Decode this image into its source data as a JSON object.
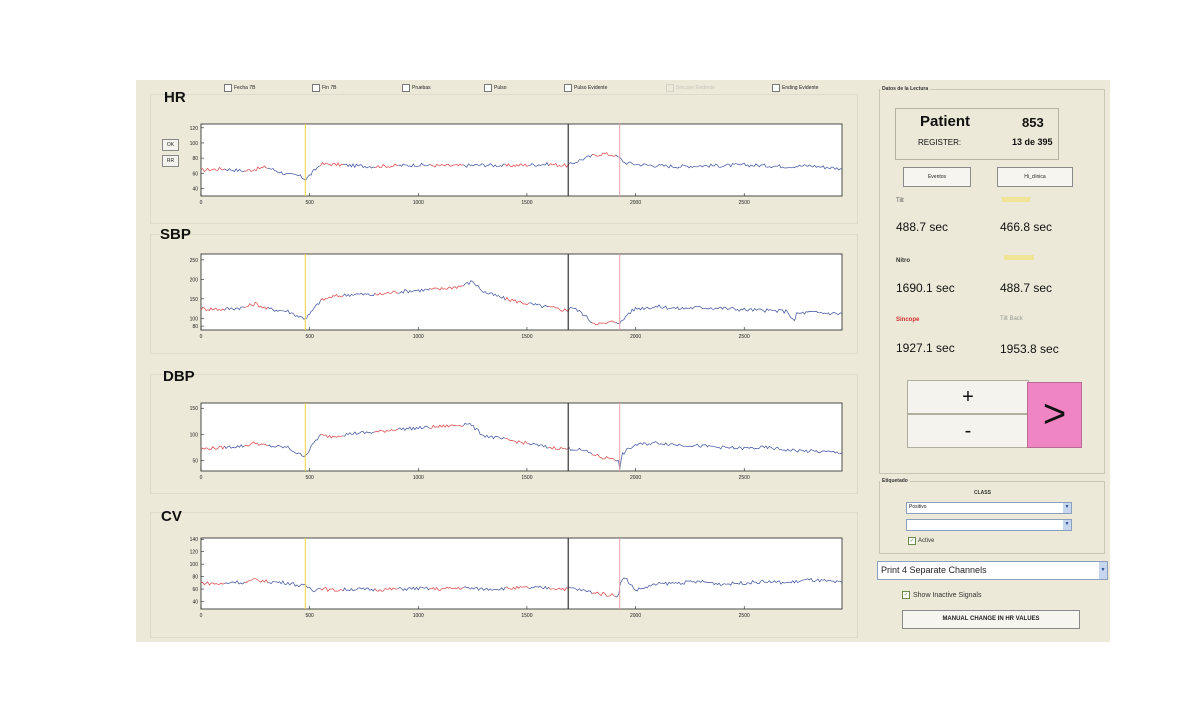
{
  "top_checkboxes": [
    {
      "label": "Fecha 7B",
      "disabled": false
    },
    {
      "label": "Fin 7B",
      "disabled": false
    },
    {
      "label": "Pruebas",
      "disabled": false
    },
    {
      "label": "Pulso",
      "disabled": false
    },
    {
      "label": "Pulso Evidente",
      "disabled": false
    },
    {
      "label": "Sincope Evidente",
      "disabled": true
    },
    {
      "label": "Ending Evidente",
      "disabled": false
    }
  ],
  "side_buttons": [
    "OK",
    "RR"
  ],
  "chart_data": [
    {
      "type": "line",
      "title": "HR",
      "ylim": [
        30,
        125
      ],
      "yticks": [
        40,
        60,
        80,
        100,
        120
      ],
      "xlim": [
        0,
        2950
      ],
      "xticks": [
        0,
        500,
        1000,
        1500,
        2000,
        2500
      ],
      "x": [
        0,
        100,
        200,
        300,
        400,
        450,
        480,
        500,
        520,
        550,
        600,
        700,
        800,
        900,
        1000,
        1100,
        1200,
        1300,
        1400,
        1500,
        1600,
        1690,
        1700,
        1750,
        1800,
        1850,
        1900,
        1927,
        1950,
        2000,
        2100,
        2200,
        2300,
        2400,
        2500,
        2600,
        2700,
        2800,
        2950
      ],
      "y": [
        64,
        66,
        63,
        68,
        58,
        57,
        52,
        57,
        63,
        72,
        72,
        70,
        69,
        70,
        71,
        70,
        70,
        71,
        70,
        71,
        72,
        70,
        72,
        78,
        83,
        86,
        84,
        80,
        74,
        72,
        70,
        69,
        70,
        70,
        71,
        70,
        69,
        70,
        66
      ]
    },
    {
      "type": "line",
      "title": "SBP",
      "ylim": [
        70,
        265
      ],
      "yticks": [
        80,
        100,
        150,
        200,
        250
      ],
      "xlim": [
        0,
        2950
      ],
      "xticks": [
        0,
        500,
        1000,
        1500,
        2000,
        2500
      ],
      "x": [
        0,
        100,
        200,
        250,
        300,
        400,
        450,
        480,
        500,
        520,
        550,
        600,
        700,
        800,
        900,
        1000,
        1100,
        1200,
        1250,
        1300,
        1400,
        1500,
        1600,
        1690,
        1700,
        1750,
        1800,
        1850,
        1900,
        1927,
        1940,
        1960,
        2000,
        2100,
        2200,
        2300,
        2400,
        2500,
        2700,
        2730,
        2740,
        2800,
        2950
      ],
      "y": [
        125,
        123,
        128,
        138,
        125,
        118,
        105,
        100,
        110,
        125,
        145,
        155,
        162,
        160,
        168,
        172,
        175,
        183,
        195,
        168,
        150,
        138,
        128,
        120,
        130,
        115,
        90,
        85,
        92,
        90,
        92,
        110,
        125,
        130,
        125,
        128,
        126,
        122,
        118,
        90,
        112,
        115,
        112
      ]
    },
    {
      "type": "line",
      "title": "DBP",
      "ylim": [
        30,
        160
      ],
      "yticks": [
        50,
        100,
        150
      ],
      "xlim": [
        0,
        2950
      ],
      "xticks": [
        0,
        500,
        1000,
        1500,
        2000,
        2500
      ],
      "x": [
        0,
        100,
        200,
        250,
        300,
        400,
        450,
        480,
        500,
        520,
        550,
        600,
        700,
        800,
        900,
        1000,
        1100,
        1200,
        1230,
        1300,
        1400,
        1500,
        1600,
        1690,
        1700,
        1750,
        1800,
        1850,
        1900,
        1920,
        1927,
        1940,
        1960,
        2000,
        2100,
        2200,
        2300,
        2400,
        2500,
        2600,
        2700,
        2800,
        2950
      ],
      "y": [
        72,
        75,
        78,
        84,
        78,
        75,
        62,
        60,
        70,
        85,
        98,
        96,
        102,
        104,
        110,
        112,
        115,
        118,
        122,
        98,
        90,
        83,
        75,
        72,
        73,
        70,
        63,
        55,
        55,
        48,
        35,
        62,
        70,
        80,
        84,
        80,
        78,
        75,
        73,
        75,
        70,
        68,
        65
      ]
    },
    {
      "type": "line",
      "title": "CV",
      "ylim": [
        28,
        142
      ],
      "yticks": [
        40,
        60,
        80,
        100,
        120,
        140
      ],
      "xlim": [
        0,
        2950
      ],
      "xticks": [
        0,
        500,
        1000,
        1500,
        2000,
        2500
      ],
      "x": [
        0,
        100,
        150,
        200,
        250,
        300,
        400,
        450,
        480,
        500,
        520,
        550,
        600,
        700,
        800,
        900,
        1000,
        1100,
        1200,
        1300,
        1400,
        1500,
        1600,
        1690,
        1700,
        1750,
        1800,
        1850,
        1900,
        1920,
        1927,
        1940,
        1960,
        2000,
        2100,
        2200,
        2300,
        2400,
        2500,
        2600,
        2700,
        2800,
        2950
      ],
      "y": [
        70,
        68,
        72,
        70,
        75,
        72,
        70,
        66,
        65,
        62,
        58,
        62,
        58,
        60,
        59,
        60,
        61,
        60,
        62,
        60,
        61,
        62,
        62,
        60,
        62,
        58,
        55,
        52,
        50,
        50,
        62,
        78,
        75,
        58,
        68,
        70,
        72,
        68,
        70,
        72,
        70,
        75,
        70
      ]
    }
  ],
  "chart_style": {
    "red": "#d94141",
    "blue": "#3b4fa0",
    "yellow": "#f0d53c",
    "black": "#333333",
    "pink": "#e8a0a8",
    "red_segments": [
      [
        0,
        100,
        200,
        300
      ],
      [
        550,
        650,
        800,
        900,
        1050,
        1200
      ],
      [
        1400,
        1500,
        1600,
        1690,
        1800,
        1900
      ]
    ],
    "markers": {
      "yellow": 480,
      "black": 1690,
      "pink": 1927
    }
  },
  "datos": {
    "legend": "Datos de la Lectura",
    "patient_label": "Patient",
    "patient_value": "853",
    "register_label": "REGISTER:",
    "register_value": "13 de 395",
    "btn_eventos": "Eventos",
    "btn_clinica": "Hi_clinica",
    "t1_label": "Tilt",
    "t1_value": "488.7 sec",
    "t2_value": "466.8 sec",
    "nitro_label": "Nitro",
    "nitro_value": "1690.1 sec",
    "t4_value": "488.7 sec",
    "syncope_label": "Sincope",
    "syncope_value": "1927.1 sec",
    "tiltback_label": "Tilt Back",
    "tiltback_value": "1953.8 sec",
    "plus": "+",
    "minus": "-",
    "next": ">"
  },
  "etiquetado": {
    "legend": "Etiquetado",
    "class_label": "CLASS",
    "select1": "Positivo",
    "select2": "",
    "active_label": "Active"
  },
  "print_select": "Print 4 Separate Channels",
  "show_inactive": "Show Inactive Signals",
  "manual_button": "MANUAL CHANGE IN HR VALUES"
}
